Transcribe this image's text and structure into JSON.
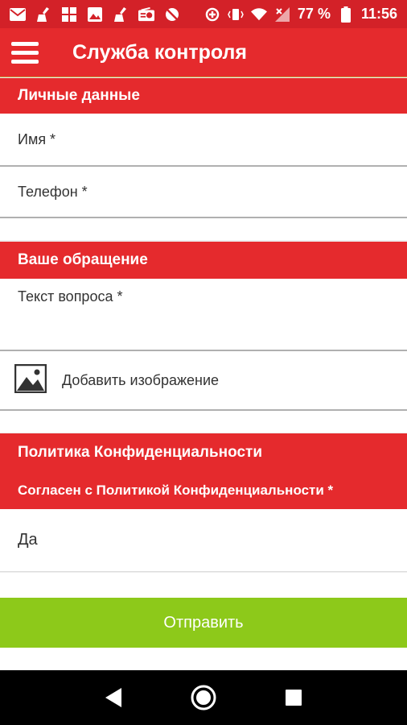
{
  "status_bar": {
    "battery_percent": "77 %",
    "time": "11:56",
    "left_icons": [
      "mail-icon",
      "broom-icon",
      "grid-icon",
      "image-icon",
      "broom-icon",
      "radio-icon",
      "no-signal-icon"
    ],
    "right_icons": [
      "data-saver-icon",
      "vibrate-icon",
      "wifi-icon",
      "no-sim-signal-icon",
      "battery-icon"
    ]
  },
  "app_bar": {
    "title": "Служба контроля"
  },
  "personal": {
    "header": "Личные данные",
    "name_placeholder": "Имя *",
    "phone_placeholder": "Телефон *"
  },
  "request": {
    "header": "Ваше обращение",
    "question_placeholder": "Текст вопроса *",
    "add_image_label": "Добавить изображение"
  },
  "privacy": {
    "header": "Политика Конфиденциальности",
    "agree_label": "Согласен с Политикой Конфиденциальности *",
    "selected_value": "Да"
  },
  "submit_label": "Отправить",
  "colors": {
    "primary_red": "#e52a2d",
    "status_red": "#d32128",
    "submit_green": "#8dc91a"
  }
}
